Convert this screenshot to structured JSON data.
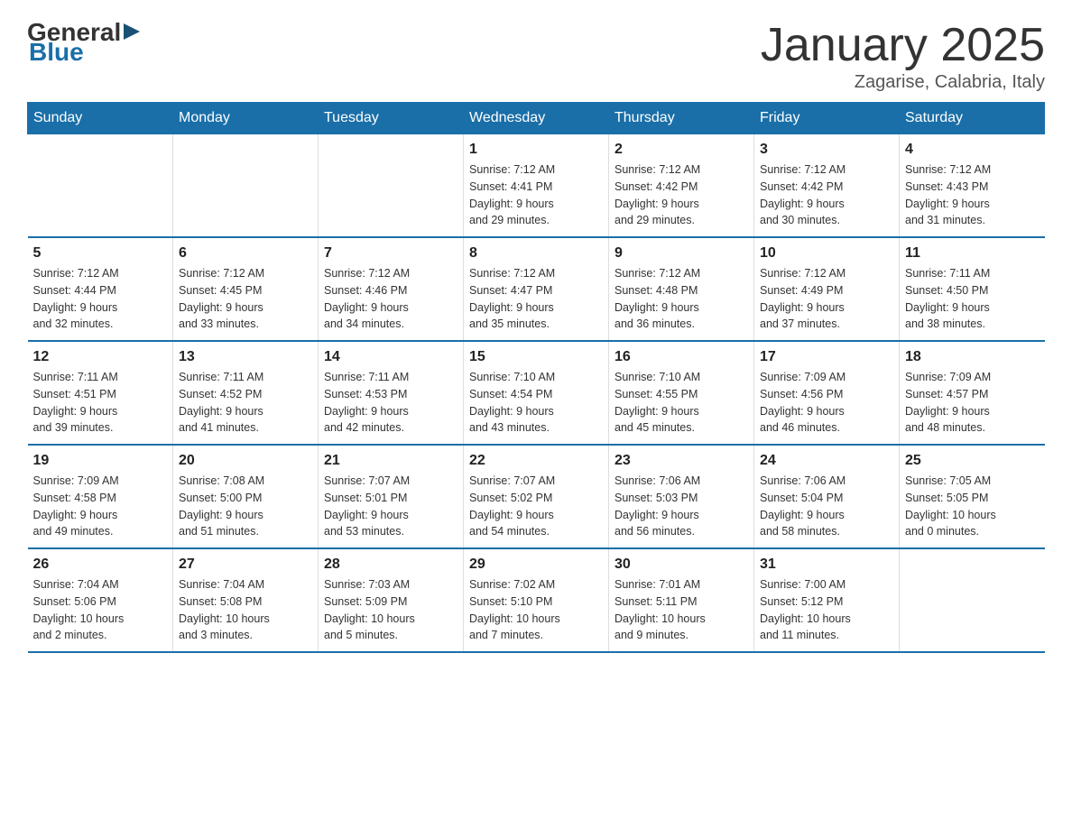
{
  "header": {
    "logo_general": "General",
    "logo_blue": "Blue",
    "title": "January 2025",
    "location": "Zagarise, Calabria, Italy"
  },
  "days_of_week": [
    "Sunday",
    "Monday",
    "Tuesday",
    "Wednesday",
    "Thursday",
    "Friday",
    "Saturday"
  ],
  "weeks": [
    [
      {
        "day": "",
        "info": ""
      },
      {
        "day": "",
        "info": ""
      },
      {
        "day": "",
        "info": ""
      },
      {
        "day": "1",
        "info": "Sunrise: 7:12 AM\nSunset: 4:41 PM\nDaylight: 9 hours\nand 29 minutes."
      },
      {
        "day": "2",
        "info": "Sunrise: 7:12 AM\nSunset: 4:42 PM\nDaylight: 9 hours\nand 29 minutes."
      },
      {
        "day": "3",
        "info": "Sunrise: 7:12 AM\nSunset: 4:42 PM\nDaylight: 9 hours\nand 30 minutes."
      },
      {
        "day": "4",
        "info": "Sunrise: 7:12 AM\nSunset: 4:43 PM\nDaylight: 9 hours\nand 31 minutes."
      }
    ],
    [
      {
        "day": "5",
        "info": "Sunrise: 7:12 AM\nSunset: 4:44 PM\nDaylight: 9 hours\nand 32 minutes."
      },
      {
        "day": "6",
        "info": "Sunrise: 7:12 AM\nSunset: 4:45 PM\nDaylight: 9 hours\nand 33 minutes."
      },
      {
        "day": "7",
        "info": "Sunrise: 7:12 AM\nSunset: 4:46 PM\nDaylight: 9 hours\nand 34 minutes."
      },
      {
        "day": "8",
        "info": "Sunrise: 7:12 AM\nSunset: 4:47 PM\nDaylight: 9 hours\nand 35 minutes."
      },
      {
        "day": "9",
        "info": "Sunrise: 7:12 AM\nSunset: 4:48 PM\nDaylight: 9 hours\nand 36 minutes."
      },
      {
        "day": "10",
        "info": "Sunrise: 7:12 AM\nSunset: 4:49 PM\nDaylight: 9 hours\nand 37 minutes."
      },
      {
        "day": "11",
        "info": "Sunrise: 7:11 AM\nSunset: 4:50 PM\nDaylight: 9 hours\nand 38 minutes."
      }
    ],
    [
      {
        "day": "12",
        "info": "Sunrise: 7:11 AM\nSunset: 4:51 PM\nDaylight: 9 hours\nand 39 minutes."
      },
      {
        "day": "13",
        "info": "Sunrise: 7:11 AM\nSunset: 4:52 PM\nDaylight: 9 hours\nand 41 minutes."
      },
      {
        "day": "14",
        "info": "Sunrise: 7:11 AM\nSunset: 4:53 PM\nDaylight: 9 hours\nand 42 minutes."
      },
      {
        "day": "15",
        "info": "Sunrise: 7:10 AM\nSunset: 4:54 PM\nDaylight: 9 hours\nand 43 minutes."
      },
      {
        "day": "16",
        "info": "Sunrise: 7:10 AM\nSunset: 4:55 PM\nDaylight: 9 hours\nand 45 minutes."
      },
      {
        "day": "17",
        "info": "Sunrise: 7:09 AM\nSunset: 4:56 PM\nDaylight: 9 hours\nand 46 minutes."
      },
      {
        "day": "18",
        "info": "Sunrise: 7:09 AM\nSunset: 4:57 PM\nDaylight: 9 hours\nand 48 minutes."
      }
    ],
    [
      {
        "day": "19",
        "info": "Sunrise: 7:09 AM\nSunset: 4:58 PM\nDaylight: 9 hours\nand 49 minutes."
      },
      {
        "day": "20",
        "info": "Sunrise: 7:08 AM\nSunset: 5:00 PM\nDaylight: 9 hours\nand 51 minutes."
      },
      {
        "day": "21",
        "info": "Sunrise: 7:07 AM\nSunset: 5:01 PM\nDaylight: 9 hours\nand 53 minutes."
      },
      {
        "day": "22",
        "info": "Sunrise: 7:07 AM\nSunset: 5:02 PM\nDaylight: 9 hours\nand 54 minutes."
      },
      {
        "day": "23",
        "info": "Sunrise: 7:06 AM\nSunset: 5:03 PM\nDaylight: 9 hours\nand 56 minutes."
      },
      {
        "day": "24",
        "info": "Sunrise: 7:06 AM\nSunset: 5:04 PM\nDaylight: 9 hours\nand 58 minutes."
      },
      {
        "day": "25",
        "info": "Sunrise: 7:05 AM\nSunset: 5:05 PM\nDaylight: 10 hours\nand 0 minutes."
      }
    ],
    [
      {
        "day": "26",
        "info": "Sunrise: 7:04 AM\nSunset: 5:06 PM\nDaylight: 10 hours\nand 2 minutes."
      },
      {
        "day": "27",
        "info": "Sunrise: 7:04 AM\nSunset: 5:08 PM\nDaylight: 10 hours\nand 3 minutes."
      },
      {
        "day": "28",
        "info": "Sunrise: 7:03 AM\nSunset: 5:09 PM\nDaylight: 10 hours\nand 5 minutes."
      },
      {
        "day": "29",
        "info": "Sunrise: 7:02 AM\nSunset: 5:10 PM\nDaylight: 10 hours\nand 7 minutes."
      },
      {
        "day": "30",
        "info": "Sunrise: 7:01 AM\nSunset: 5:11 PM\nDaylight: 10 hours\nand 9 minutes."
      },
      {
        "day": "31",
        "info": "Sunrise: 7:00 AM\nSunset: 5:12 PM\nDaylight: 10 hours\nand 11 minutes."
      },
      {
        "day": "",
        "info": ""
      }
    ]
  ]
}
